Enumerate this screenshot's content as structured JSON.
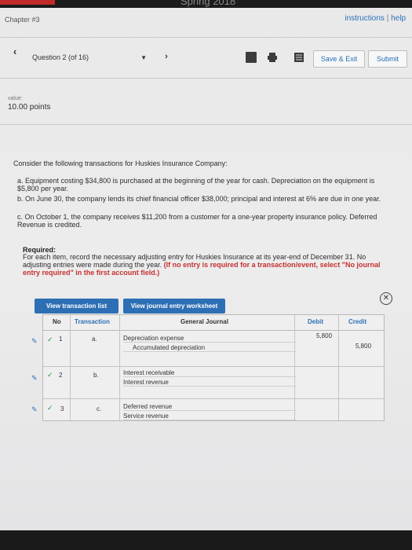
{
  "header": {
    "term": "Spring 2018",
    "chapter": "Chapter #3",
    "instructions_link": "instructions",
    "separator": "|",
    "help_link": "help"
  },
  "nav": {
    "prev_icon": "chevron-left",
    "question_label": "Question 2 (of 16)",
    "next_icon": "chevron-right",
    "save_exit_label": "Save & Exit",
    "submit_label": "Submit"
  },
  "value": {
    "label": "value:",
    "points": "10.00 points"
  },
  "question": {
    "intro": "Consider the following transactions for Huskies Insurance Company:",
    "items": [
      "a. Equipment costing $34,800 is purchased at the beginning of the year for cash. Depreciation on the equipment is $5,800 per year.",
      "b. On June 30, the company lends its chief financial officer $38,000; principal and interest at 6% are due in one year.",
      "c. On October 1, the company receives $11,200 from a customer for a one-year property insurance policy. Deferred Revenue is credited."
    ],
    "required_title": "Required:",
    "required_text": "For each item, record the necessary adjusting entry for Huskies Insurance at its year-end of December 31. No adjusting entries were made during the year.",
    "required_note": "(If no entry is required for a transaction/event, select \"No journal entry required\" in the first account field.)"
  },
  "tabs": {
    "transaction_list": "View transaction list",
    "journal_worksheet": "View journal entry worksheet"
  },
  "journal": {
    "headers": {
      "no": "No",
      "transaction": "Transaction",
      "general_journal": "General Journal",
      "debit": "Debit",
      "credit": "Credit"
    },
    "rows": [
      {
        "no": "1",
        "transaction": "a.",
        "debit_account": "Depreciation expense",
        "credit_account": "Accumulated depreciation",
        "debit": "5,800",
        "credit": "5,800"
      },
      {
        "no": "2",
        "transaction": "b.",
        "debit_account": "Interest receivable",
        "credit_account": "Interest revenue",
        "debit": "",
        "credit": ""
      },
      {
        "no": "3",
        "transaction": "c.",
        "debit_account": "Deferred revenue",
        "credit_account": "Service revenue",
        "debit": "",
        "credit": ""
      }
    ]
  },
  "colors": {
    "link": "#2a6fb8",
    "tab": "#2d6fb5",
    "required_note": "#c63030",
    "check": "#2a8f3d"
  }
}
